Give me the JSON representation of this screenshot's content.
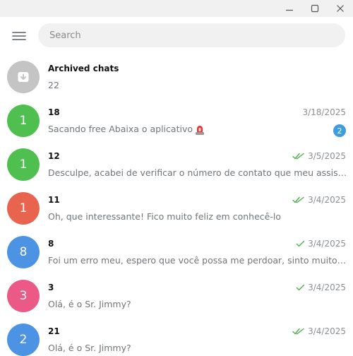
{
  "search": {
    "placeholder": "Search"
  },
  "archived": {
    "title": "Archived chats",
    "count": "22"
  },
  "colors": {
    "accent": "#3d9de0",
    "check": "#4fae4e",
    "archive_avatar": "#c4c4c4"
  },
  "chats": [
    {
      "avatar_letter": "1",
      "avatar_color": "#4fc04f",
      "name": "18",
      "preview": "Sacando free   Abaixa o aplicativo",
      "preview_icon": "siren-emoji-icon",
      "date": "3/18/2025",
      "status": "",
      "unread": "2"
    },
    {
      "avatar_letter": "1",
      "avatar_color": "#4fc04f",
      "name": "12",
      "preview": "Desculpe, acabei de verificar o número de contato que meu assistente",
      "date": "3/5/2025",
      "status": "read",
      "unread": ""
    },
    {
      "avatar_letter": "1",
      "avatar_color": "#e8644f",
      "name": "11",
      "preview": "Oh, que interessante! Fico muito feliz em conhecê-lo",
      "date": "3/4/2025",
      "status": "read",
      "unread": ""
    },
    {
      "avatar_letter": "8",
      "avatar_color": "#4d93e4",
      "name": "8",
      "preview": "Foi um erro meu, espero que você possa me perdoar, sinto muito me",
      "date": "3/4/2025",
      "status": "sent",
      "unread": ""
    },
    {
      "avatar_letter": "3",
      "avatar_color": "#eb5a86",
      "name": "3",
      "preview": "Olá, é o Sr. Jimmy?",
      "date": "3/4/2025",
      "status": "sent",
      "unread": ""
    },
    {
      "avatar_letter": "2",
      "avatar_color": "#4d93e4",
      "name": "21",
      "preview": "Olá, é o Sr. Jimmy?",
      "date": "3/4/2025",
      "status": "read",
      "unread": ""
    }
  ]
}
